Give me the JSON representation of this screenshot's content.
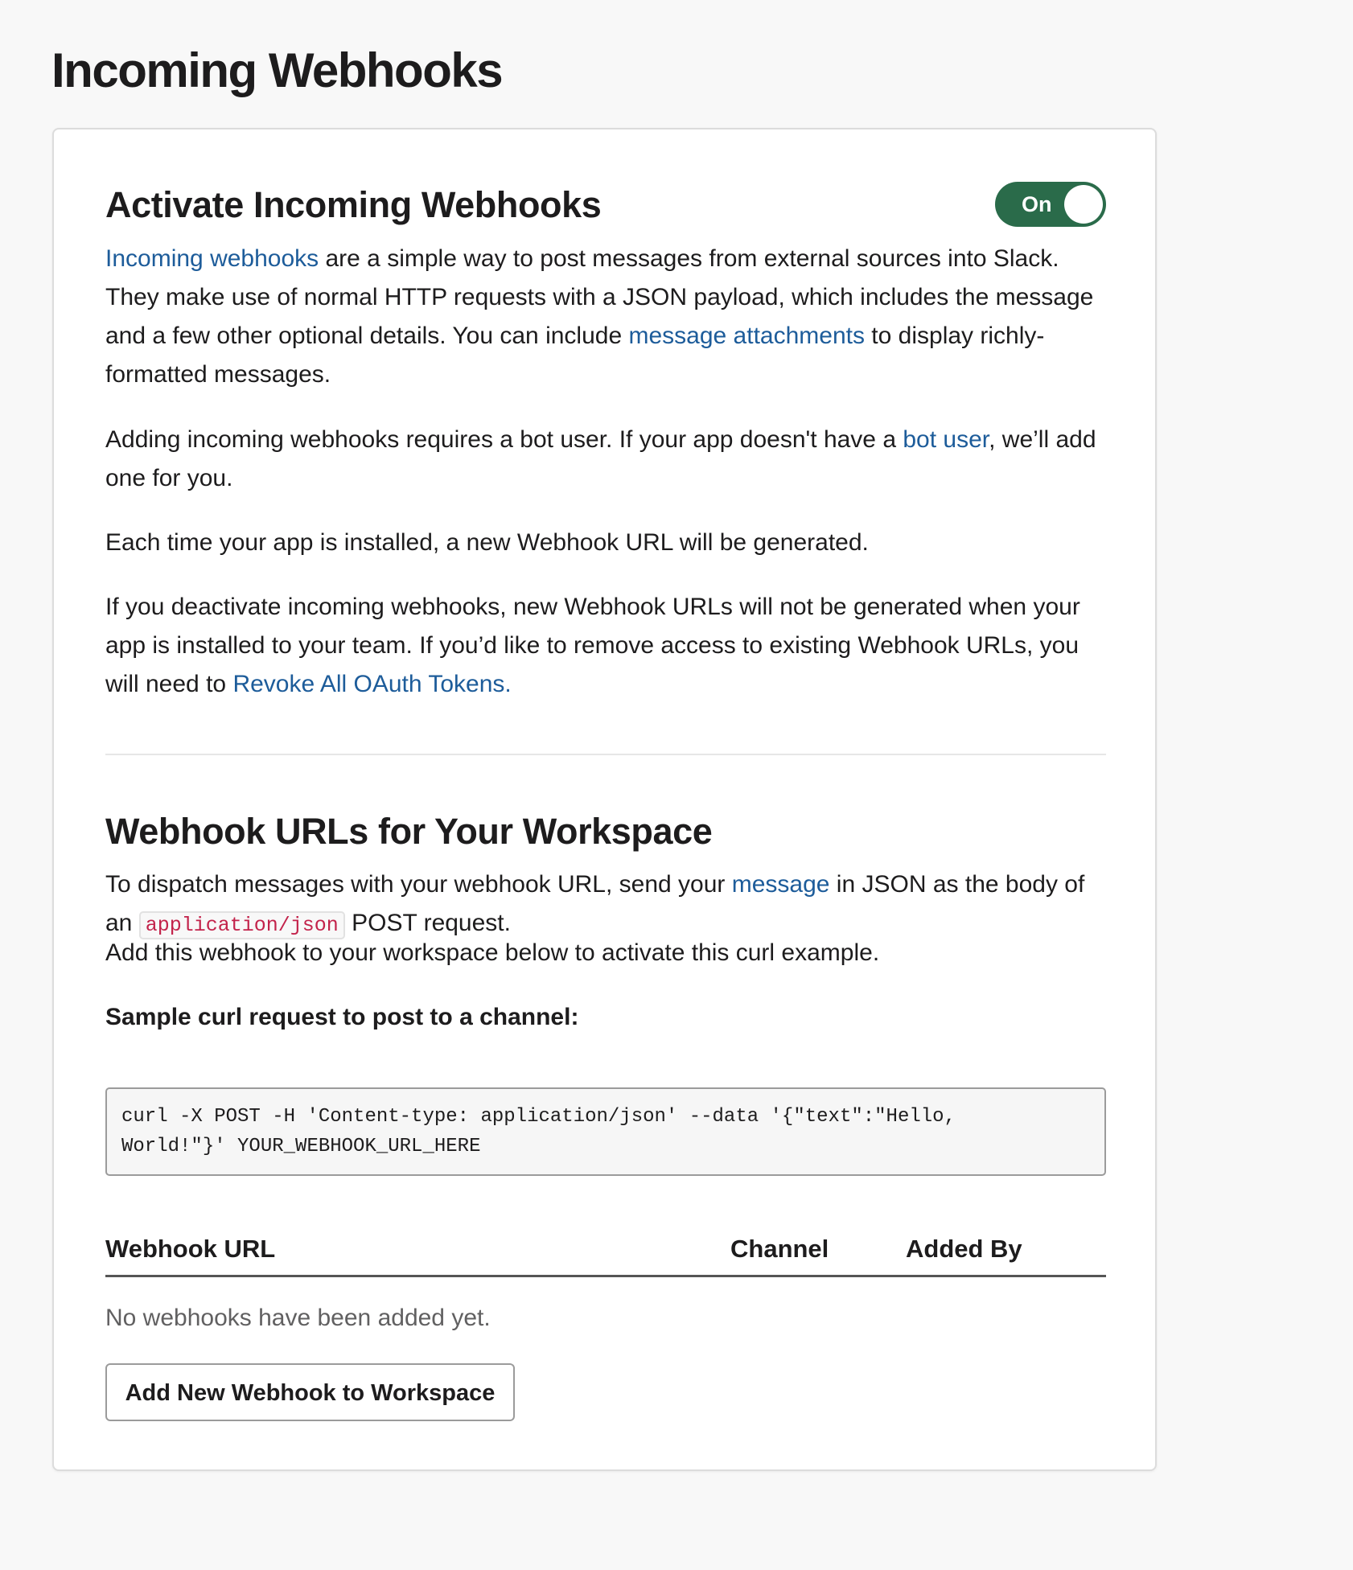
{
  "page": {
    "title": "Incoming Webhooks"
  },
  "activate": {
    "heading": "Activate Incoming Webhooks",
    "toggle_label": "On",
    "para1": {
      "link_incoming": "Incoming webhooks",
      "text_a": " are a simple way to post messages from external sources into Slack. They make use of normal HTTP requests with a JSON payload, which includes the message and a few other optional details. You can include ",
      "link_attachments": "message attachments",
      "text_b": " to display richly-formatted messages."
    },
    "para2": {
      "text_a": "Adding incoming webhooks requires a bot user. If your app doesn't have a ",
      "link_bot": "bot user",
      "text_b": ", we’ll add one for you."
    },
    "para3": "Each time your app is installed, a new Webhook URL will be generated.",
    "para4": {
      "text_a": "If you deactivate incoming webhooks, new Webhook URLs will not be generated when your app is installed to your team. If you’d like to remove access to existing Webhook URLs, you will need to ",
      "link_revoke": "Revoke All OAuth Tokens."
    }
  },
  "urls": {
    "heading": "Webhook URLs for Your Workspace",
    "para1": {
      "text_a": "To dispatch messages with your webhook URL, send your ",
      "link_message": "message",
      "text_b": " in JSON as the body of an ",
      "code": "application/json",
      "text_c": " POST request."
    },
    "para2": "Add this webhook to your workspace below to activate this curl example.",
    "sample_label": "Sample curl request to post to a channel:",
    "sample_code": "curl -X POST -H 'Content-type: application/json' --data '{\"text\":\"Hello,\nWorld!\"}' YOUR_WEBHOOK_URL_HERE",
    "table": {
      "col_url": "Webhook URL",
      "col_channel": "Channel",
      "col_added_by": "Added By",
      "empty_text": "No webhooks have been added yet."
    },
    "add_button_label": "Add New Webhook to Workspace"
  },
  "colors": {
    "toggle_on": "#2a6b4a",
    "link": "#1d5c9a",
    "inline_code": "#c3234b"
  }
}
